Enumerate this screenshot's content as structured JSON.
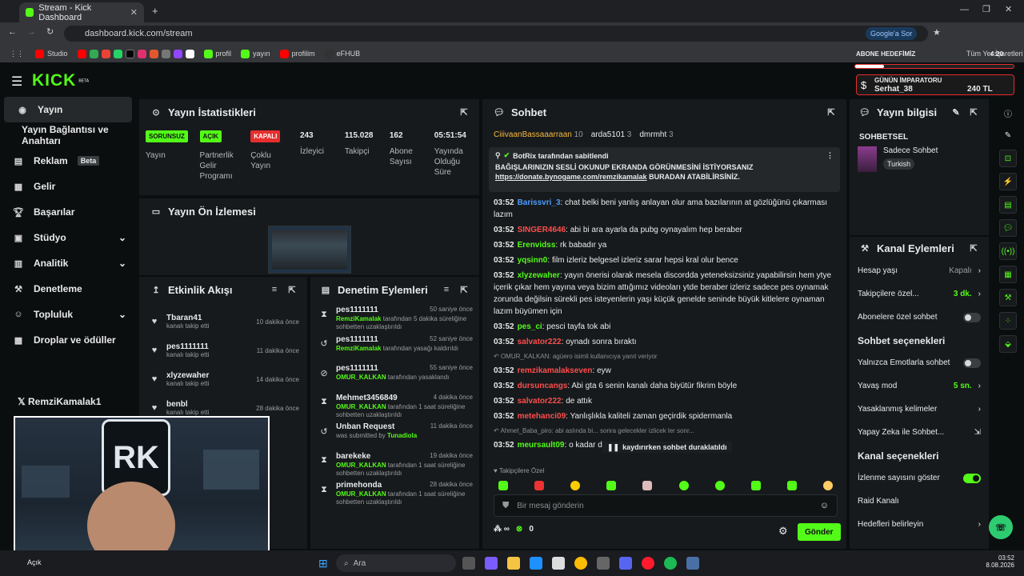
{
  "browser": {
    "tab_title": "Stream - Kick Dashboard",
    "url": "dashboard.kick.com/stream",
    "bookmarks": [
      "Studio",
      "profil",
      "yayın",
      "profilim",
      "eFHUB"
    ],
    "google_btn": "Google'a Sor",
    "all_bookmarks": "Tüm Yer İşaretleri"
  },
  "overlay": {
    "goal_label": "ABONE HEDEFİMİZ",
    "clock": "4:20",
    "emperor_title": "GÜNÜN İMPARATORU",
    "emperor_name": "Serhat_38",
    "emperor_amount": "240 TL"
  },
  "brand": {
    "logo": "KICK",
    "beta": "BETA"
  },
  "sidebar": {
    "items": [
      {
        "label": "Yayın",
        "icon": "broadcast-icon"
      },
      {
        "label": "Yayın Bağlantısı ve Anahtarı",
        "icon": ""
      },
      {
        "label": "Reklam",
        "badge": "Beta",
        "icon": "ad-icon"
      },
      {
        "label": "Gelir",
        "icon": "income-icon"
      },
      {
        "label": "Başarılar",
        "icon": "trophy-icon"
      },
      {
        "label": "Stüdyo",
        "icon": "studio-icon"
      },
      {
        "label": "Analitik",
        "icon": "analytics-icon"
      },
      {
        "label": "Denetleme",
        "icon": "moderation-icon"
      },
      {
        "label": "Topluluk",
        "icon": "community-icon"
      },
      {
        "label": "Droplar ve ödüller",
        "icon": "drops-icon"
      }
    ],
    "watermark": "RemziKamalak1"
  },
  "stats": {
    "title": "Yayın İstatistikleri",
    "cols": [
      {
        "badge": "SORUNSUZ",
        "label": "Yayın",
        "color": "#53fc18"
      },
      {
        "badge": "AÇIK",
        "label": "Partnerlik Gelir Programı",
        "color": "#53fc18"
      },
      {
        "badge": "KAPALI",
        "label": "Çoklu Yayın",
        "color": "#e62e2e"
      },
      {
        "value": "243",
        "label": "İzleyici"
      },
      {
        "value": "115.028",
        "label": "Takipçi"
      },
      {
        "value": "162",
        "label": "Abone Sayısı"
      },
      {
        "value": "05:51:54",
        "label": "Yayında Olduğu Süre"
      }
    ]
  },
  "preview": {
    "title": "Yayın Ön İzlemesi"
  },
  "activity": {
    "title": "Etkinlik Akışı",
    "rows": [
      {
        "name": "Tbaran41",
        "sub": "kanalı takip etti",
        "time": "10 dakika önce"
      },
      {
        "name": "pes1111111",
        "sub": "kanalı takip etti",
        "time": "11 dakika önce"
      },
      {
        "name": "xlyzewaher",
        "sub": "kanalı takip etti",
        "time": "14 dakika önce"
      },
      {
        "name": "benbl",
        "sub": "kanalı takip etti",
        "time": "28 dakika önce"
      }
    ]
  },
  "modlog": {
    "title": "Denetim Eylemleri",
    "rows": [
      {
        "name": "pes1111111",
        "time": "50 saniye önce",
        "mod": "RemziKamalak",
        "text": "tarafından 5 dakika süreliğine sohbetten uzaklaştırıldı"
      },
      {
        "name": "pes1111111",
        "time": "52 saniye önce",
        "mod": "RemziKamalak",
        "text": "tarafından yasağı kaldırıldı"
      },
      {
        "name": "pes1111111",
        "time": "55 saniye önce",
        "mod": "OMUR_KALKAN",
        "text": "tarafından yasaklandı"
      },
      {
        "name": "Mehmet3456849",
        "time": "4 dakika önce",
        "mod": "OMUR_KALKAN",
        "text": "tarafından 1 saat süreliğine sohbetten uzaklaştırıldı"
      },
      {
        "name": "Unban Request",
        "time": "11 dakika önce",
        "mod": "Tunadiola",
        "text": "was submitted by"
      },
      {
        "name": "barekeke",
        "time": "19 dakika önce",
        "mod": "OMUR_KALKAN",
        "text": "tarafından 1 saat süreliğine sohbetten uzaklaştırıldı"
      },
      {
        "name": "primehonda",
        "time": "28 dakika önce",
        "mod": "OMUR_KALKAN",
        "text": "tarafından 1 saat süreliğine sohbetten uzaklaştırıldı"
      }
    ]
  },
  "chat": {
    "title": "Sohbet",
    "top_gifters": [
      {
        "name": "CiiivaanBassaaarraan",
        "count": "10"
      },
      {
        "name": "arda5101",
        "count": "3"
      },
      {
        "name": "dmrmht",
        "count": "3"
      }
    ],
    "pinned_by": "BotRix tarafından sabitlendi",
    "pinned_text": "BAĞIŞLARINIZIN SESLİ OKUNUP EKRANDA GÖRÜNMESİNİ İSTİYORSANIZ",
    "pinned_link": "https://donate.bynogame.com/remzikamalak",
    "pinned_tail": "BURADAN ATABİLİRSİNİZ.",
    "messages": [
      {
        "time": "03:52",
        "user": "Barissvri_3",
        "color": "#4a9cff",
        "text": "chat belki beni yanlış anlayan olur ama bazılarının at gözlüğünü çıkarması lazım"
      },
      {
        "time": "03:52",
        "user": "SINGER4646",
        "color": "#ff4d4d",
        "text": "abi bi ara ayarla da pubg oynayalım hep beraber"
      },
      {
        "time": "03:52",
        "user": "Erenvidss",
        "color": "#53fc18",
        "text": "rk babadır ya"
      },
      {
        "time": "03:52",
        "user": "yqsinn0",
        "color": "#53fc18",
        "text": "film izleriz belgesel izleriz sarar hepsi kral olur bence"
      },
      {
        "time": "03:52",
        "user": "xlyzewaher",
        "color": "#53fc18",
        "text": "yayın önerisi olarak mesela discordda yeteneksizsiniz yapabilirsin hem ytye içerik çıkar hem yayına veya bizim attığımız videoları ytde beraber izleriz sadece pes oynamak zorunda değilsin sürekli pes isteyenlerin yaşı küçük genelde seninde büyük kitlelere oynaman lazım büyümen için"
      },
      {
        "time": "03:52",
        "user": "pes_ci",
        "color": "#53fc18",
        "text": "pesci tayfa tok abi"
      },
      {
        "time": "03:52",
        "user": "salvator222",
        "color": "#ff4d4d",
        "text": "oynadı sonra bıraktı"
      },
      {
        "reply": "OMUR_KALKAN: agüero isimli kullanıcıya yanıt veriyor"
      },
      {
        "time": "03:52",
        "user": "remzikamalakseven",
        "color": "#ff4d4d",
        "text": "eyw"
      },
      {
        "time": "03:52",
        "user": "dursuncangs",
        "color": "#ff4d4d",
        "text": "Abi gta 6 senin kanalı daha biyütür fikrim böyle"
      },
      {
        "time": "03:52",
        "user": "salvator222",
        "color": "#ff4d4d",
        "text": "de attık"
      },
      {
        "time": "03:52",
        "user": "metehanci09",
        "color": "#ff4d4d",
        "text": "Yanlışlıkla kaliteli zaman geçirdik spidermanla"
      },
      {
        "reply": "Ahmet_Baba_piro: abi aslında bi... sonra gelecekler izlicek ler sonr..."
      },
      {
        "time": "03:52",
        "user": "meursault09",
        "color": "#53fc18",
        "text": "o kadar de..."
      }
    ],
    "paused_label": "kaydırırken sohbet duraklatıldı",
    "followers_only": "Takipçilere Özel",
    "input_placeholder": "Bir mesaj gönderin",
    "points": "0",
    "send_label": "Gönder"
  },
  "info": {
    "title": "Yayın bilgisi",
    "category": "SOHBETSEL",
    "stream_title": "Sadece Sohbet",
    "tag": "Turkish"
  },
  "actions": {
    "title": "Kanal Eylemleri",
    "rows": [
      {
        "label": "Hesap yaşı",
        "value": "Kapalı",
        "type": "chevron"
      },
      {
        "label": "Takipçilere özel...",
        "value": "3 dk.",
        "type": "chevron",
        "green": true
      },
      {
        "label": "Abonelere özel sohbet",
        "type": "toggle",
        "on": false
      }
    ],
    "chat_opts_title": "Sohbet seçenekleri",
    "chat_opts": [
      {
        "label": "Yalnızca Emotlarla sohbet",
        "type": "toggle",
        "on": false
      },
      {
        "label": "Yavaş mod",
        "value": "5 sn.",
        "type": "chevron",
        "green": true
      },
      {
        "label": "Yasaklanmış kelimeler",
        "type": "chevron"
      },
      {
        "label": "Yapay Zeka ile Sohbet...",
        "type": "ext"
      }
    ],
    "channel_opts_title": "Kanal seçenekleri",
    "channel_opts": [
      {
        "label": "İzlenme sayısını göster",
        "type": "toggle",
        "on": true
      },
      {
        "label": "Raid Kanalı",
        "type": "none"
      },
      {
        "label": "Hedefleri belirleyin",
        "type": "chevron"
      }
    ]
  },
  "webcam": {
    "logo": "RK"
  },
  "taskbar": {
    "status": "Açık",
    "search": "Ara",
    "time": "03:52",
    "date": "8.08.2026"
  }
}
